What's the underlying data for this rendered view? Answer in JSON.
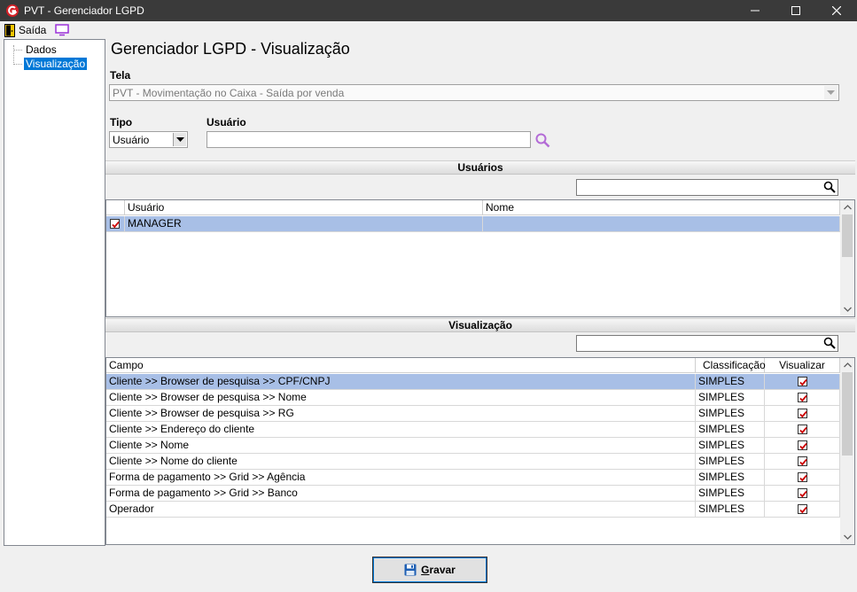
{
  "window": {
    "title": "PVT - Gerenciador LGPD",
    "controls": [
      "minimize-icon",
      "maximize-icon",
      "close-icon"
    ]
  },
  "menu": {
    "exit_label": "Saída",
    "exit_icon": "exit-door-icon",
    "screen_icon": "monitor-icon"
  },
  "tree": {
    "items": [
      {
        "label": "Dados",
        "selected": false
      },
      {
        "label": "Visualização",
        "selected": true
      }
    ]
  },
  "page": {
    "title": "Gerenciador LGPD - Visualização"
  },
  "form": {
    "tela_label": "Tela",
    "tela_value": "PVT - Movimentação no Caixa - Saída por venda",
    "tipo_label": "Tipo",
    "tipo_value": "Usuário",
    "usuario_label": "Usuário",
    "usuario_value": ""
  },
  "users_section": {
    "title": "Usuários",
    "search_value": "",
    "columns": [
      "Usuário",
      "Nome"
    ],
    "rows": [
      {
        "usuario": "MANAGER",
        "nome": "",
        "checked": true,
        "selected": true
      }
    ]
  },
  "view_section": {
    "title": "Visualização",
    "search_value": "",
    "columns": [
      "Campo",
      "Classificação",
      "Visualizar"
    ],
    "rows": [
      {
        "campo": "Cliente  >> Browser de pesquisa >> CPF/CNPJ",
        "classificacao": "SIMPLES",
        "visualizar": true,
        "selected": true
      },
      {
        "campo": "Cliente  >> Browser de pesquisa >> Nome",
        "classificacao": "SIMPLES",
        "visualizar": true,
        "selected": false
      },
      {
        "campo": "Cliente  >> Browser de pesquisa >> RG",
        "classificacao": "SIMPLES",
        "visualizar": true,
        "selected": false
      },
      {
        "campo": "Cliente >> Endereço do cliente",
        "classificacao": "SIMPLES",
        "visualizar": true,
        "selected": false
      },
      {
        "campo": "Cliente >> Nome",
        "classificacao": "SIMPLES",
        "visualizar": true,
        "selected": false
      },
      {
        "campo": "Cliente >> Nome do cliente",
        "classificacao": "SIMPLES",
        "visualizar": true,
        "selected": false
      },
      {
        "campo": "Forma de pagamento >> Grid >> Agência",
        "classificacao": "SIMPLES",
        "visualizar": true,
        "selected": false
      },
      {
        "campo": "Forma de pagamento >> Grid >> Banco",
        "classificacao": "SIMPLES",
        "visualizar": true,
        "selected": false
      },
      {
        "campo": "Operador",
        "classificacao": "SIMPLES",
        "visualizar": true,
        "selected": false
      }
    ]
  },
  "footer": {
    "save_label": "Gravar",
    "save_icon": "floppy-disk-icon"
  },
  "colors": {
    "titlebar": "#3a3a3a",
    "selection": "#0078d7",
    "row_selected": "#a8bfe6",
    "check": "#cc0000",
    "search_accent": "#b36bd6"
  }
}
